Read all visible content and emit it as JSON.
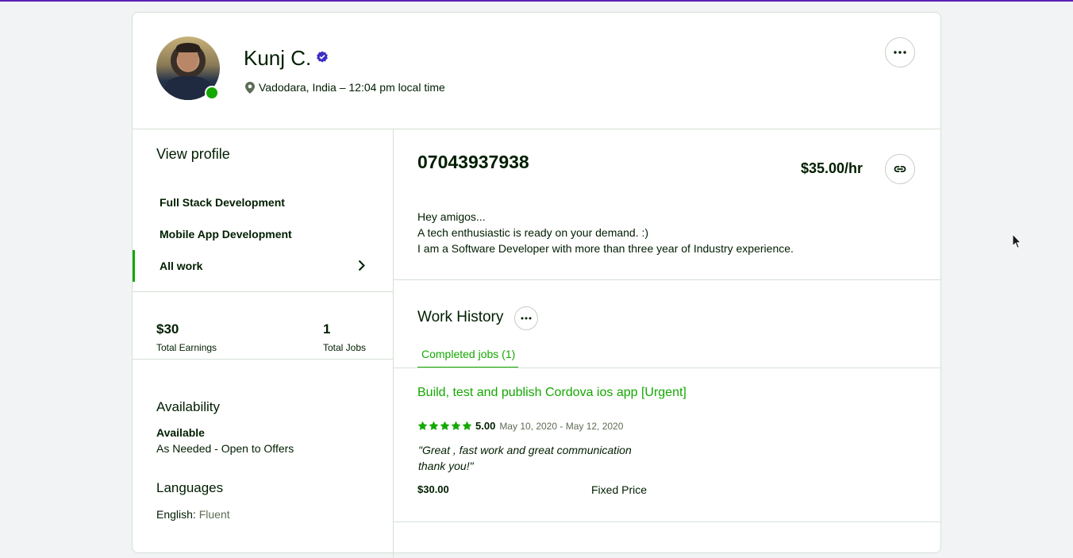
{
  "profile": {
    "name": "Kunj C.",
    "location": "Vadodara, India – 12:04 pm local time"
  },
  "sidebar": {
    "view_profile": "View profile",
    "items": [
      {
        "label": "Full Stack Development"
      },
      {
        "label": "Mobile App Development"
      },
      {
        "label": "All work"
      }
    ],
    "earnings_value": "$30",
    "earnings_label": "Total Earnings",
    "jobs_value": "1",
    "jobs_label": "Total Jobs",
    "availability_title": "Availability",
    "availability_status": "Available",
    "availability_detail": "As Needed - Open to Offers",
    "languages_title": "Languages",
    "language_name": "English:",
    "language_level": "Fluent"
  },
  "main": {
    "title": "07043937938",
    "rate": "$35.00/hr",
    "bio": [
      "Hey amigos...",
      "A tech enthusiastic is ready on your demand. :)",
      "I am a Software Developer with more than three year of Industry experience."
    ],
    "work_history_title": "Work History",
    "tab_completed": "Completed jobs (1)",
    "job": {
      "title": "Build, test and publish Cordova ios app [Urgent]",
      "rating": 5,
      "score": "5.00",
      "dates": "May 10, 2020 - May 12, 2020",
      "review_line1": "\"Great , fast work and great communication",
      "review_line2": "thank you!\"",
      "amount": "$30.00",
      "price_type": "Fixed Price"
    }
  },
  "colors": {
    "accent_green": "#14a800",
    "top_bar": "#5b21b6",
    "verified": "#3c2fc4"
  },
  "icons": [
    "verified-badge-icon",
    "location-pin-icon",
    "more-icon",
    "chevron-right-icon",
    "link-icon",
    "star-icon",
    "mouse-cursor-icon"
  ]
}
